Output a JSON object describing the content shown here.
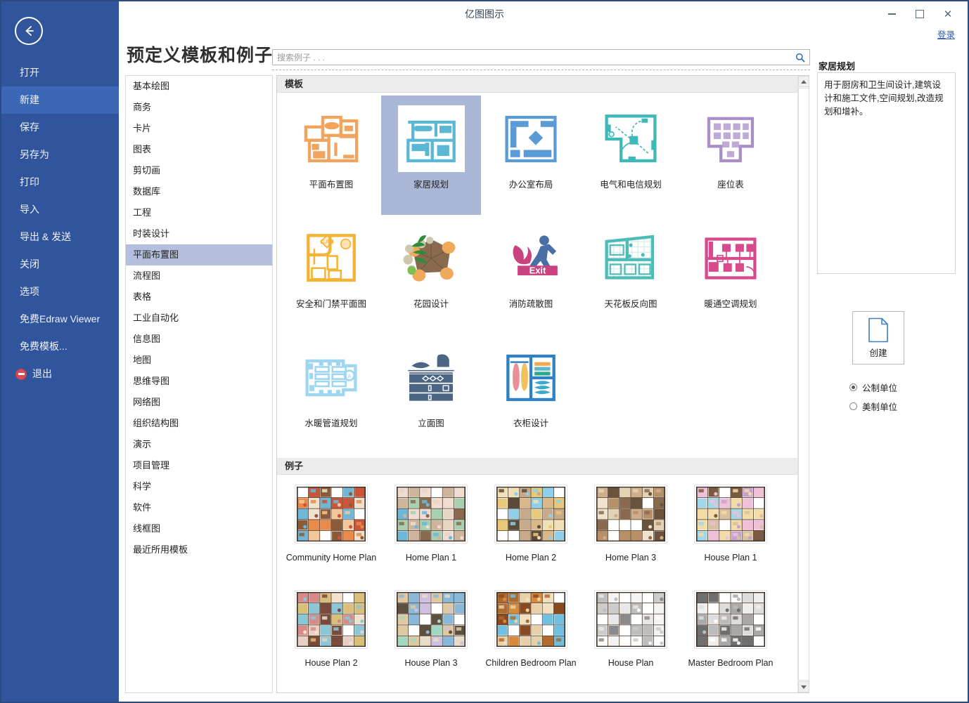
{
  "window": {
    "title": "亿图图示",
    "minimize_label": "–",
    "maximize_label": "□",
    "close_label": "✕"
  },
  "rail": {
    "back_icon": "back-arrow-icon",
    "items": [
      {
        "label": "打开",
        "active": false
      },
      {
        "label": "新建",
        "active": true
      },
      {
        "label": "保存",
        "active": false
      },
      {
        "label": "另存为",
        "active": false
      },
      {
        "label": "打印",
        "active": false
      },
      {
        "label": "导入",
        "active": false
      },
      {
        "label": "导出 & 发送",
        "active": false
      },
      {
        "label": "关闭",
        "active": false
      },
      {
        "label": "选项",
        "active": false
      },
      {
        "label": "免费Edraw Viewer",
        "active": false
      },
      {
        "label": "免费模板...",
        "active": false
      }
    ],
    "exit_label": "退出"
  },
  "header": {
    "page_title": "预定义模板和例子",
    "signin_label": "登录"
  },
  "search": {
    "value": "",
    "placeholder": "搜索例子 . . .",
    "icon": "search-icon"
  },
  "categories": {
    "items": [
      {
        "label": "基本绘图",
        "active": false
      },
      {
        "label": "商务",
        "active": false
      },
      {
        "label": "卡片",
        "active": false
      },
      {
        "label": "图表",
        "active": false
      },
      {
        "label": "剪切画",
        "active": false
      },
      {
        "label": "数据库",
        "active": false
      },
      {
        "label": "工程",
        "active": false
      },
      {
        "label": "时装设计",
        "active": false
      },
      {
        "label": "平面布置图",
        "active": true
      },
      {
        "label": "流程图",
        "active": false
      },
      {
        "label": "表格",
        "active": false
      },
      {
        "label": "工业自动化",
        "active": false
      },
      {
        "label": "信息图",
        "active": false
      },
      {
        "label": "地图",
        "active": false
      },
      {
        "label": "思维导图",
        "active": false
      },
      {
        "label": "网络图",
        "active": false
      },
      {
        "label": "组织结构图",
        "active": false
      },
      {
        "label": "演示",
        "active": false
      },
      {
        "label": "项目管理",
        "active": false
      },
      {
        "label": "科学",
        "active": false
      },
      {
        "label": "软件",
        "active": false
      },
      {
        "label": "线框图",
        "active": false
      },
      {
        "label": "最近所用模板",
        "active": false
      }
    ]
  },
  "templates": {
    "section_label": "模板",
    "items": [
      {
        "label": "平面布置图",
        "icon": "floor-plan-icon",
        "color": "#f2a45c",
        "selected": false
      },
      {
        "label": "家居规划",
        "icon": "home-plan-icon",
        "color": "#5bb8d4",
        "selected": true
      },
      {
        "label": "办公室布局",
        "icon": "office-layout-icon",
        "color": "#5b9bd5",
        "selected": false
      },
      {
        "label": "电气和电信规划",
        "icon": "electrical-plan-icon",
        "color": "#3fb8b8",
        "selected": false
      },
      {
        "label": "座位表",
        "icon": "seating-chart-icon",
        "color": "#a98fc8",
        "selected": false
      },
      {
        "label": "安全和门禁平面图",
        "icon": "security-plan-icon",
        "color": "#f5b335",
        "selected": false
      },
      {
        "label": "花园设计",
        "icon": "garden-design-icon",
        "color": "#8a6a4f",
        "selected": false
      },
      {
        "label": "消防疏散图",
        "icon": "fire-escape-icon",
        "color": "#c9437f",
        "selected": false
      },
      {
        "label": "天花板反向图",
        "icon": "reflected-ceiling-icon",
        "color": "#4bbcb8",
        "selected": false
      },
      {
        "label": "暖通空调规划",
        "icon": "hvac-plan-icon",
        "color": "#d94a8c",
        "selected": false
      },
      {
        "label": "水暖管道规划",
        "icon": "plumbing-plan-icon",
        "color": "#9ed6ef",
        "selected": false
      },
      {
        "label": "立面图",
        "icon": "elevation-icon",
        "color": "#4d6585",
        "selected": false
      },
      {
        "label": "衣柜设计",
        "icon": "wardrobe-design-icon",
        "color": "#2f80c4",
        "selected": false
      }
    ]
  },
  "examples": {
    "section_label": "例子",
    "items": [
      {
        "label": "Community Home Plan"
      },
      {
        "label": "Home Plan 1"
      },
      {
        "label": "Home Plan 2"
      },
      {
        "label": "Home Plan 3"
      },
      {
        "label": "House Plan 1"
      },
      {
        "label": "House Plan 2"
      },
      {
        "label": "House Plan 3"
      },
      {
        "label": "Children Bedroom Plan"
      },
      {
        "label": "House Plan"
      },
      {
        "label": "Master Bedroom Plan"
      }
    ]
  },
  "info": {
    "title": "家居规划",
    "description": "用于厨房和卫生间设计,建筑设计和施工文件,空间规划,改造规划和增补。",
    "create_label": "创建",
    "units": [
      {
        "label": "公制单位",
        "selected": true
      },
      {
        "label": "美制单位",
        "selected": false
      }
    ]
  },
  "colors": {
    "rail_bg": "#31559c",
    "rail_active": "#3c67b4",
    "selection": "#aab8d8",
    "category_active": "#b3bfdd",
    "section_header": "#ececec",
    "link": "#2a5db0"
  }
}
